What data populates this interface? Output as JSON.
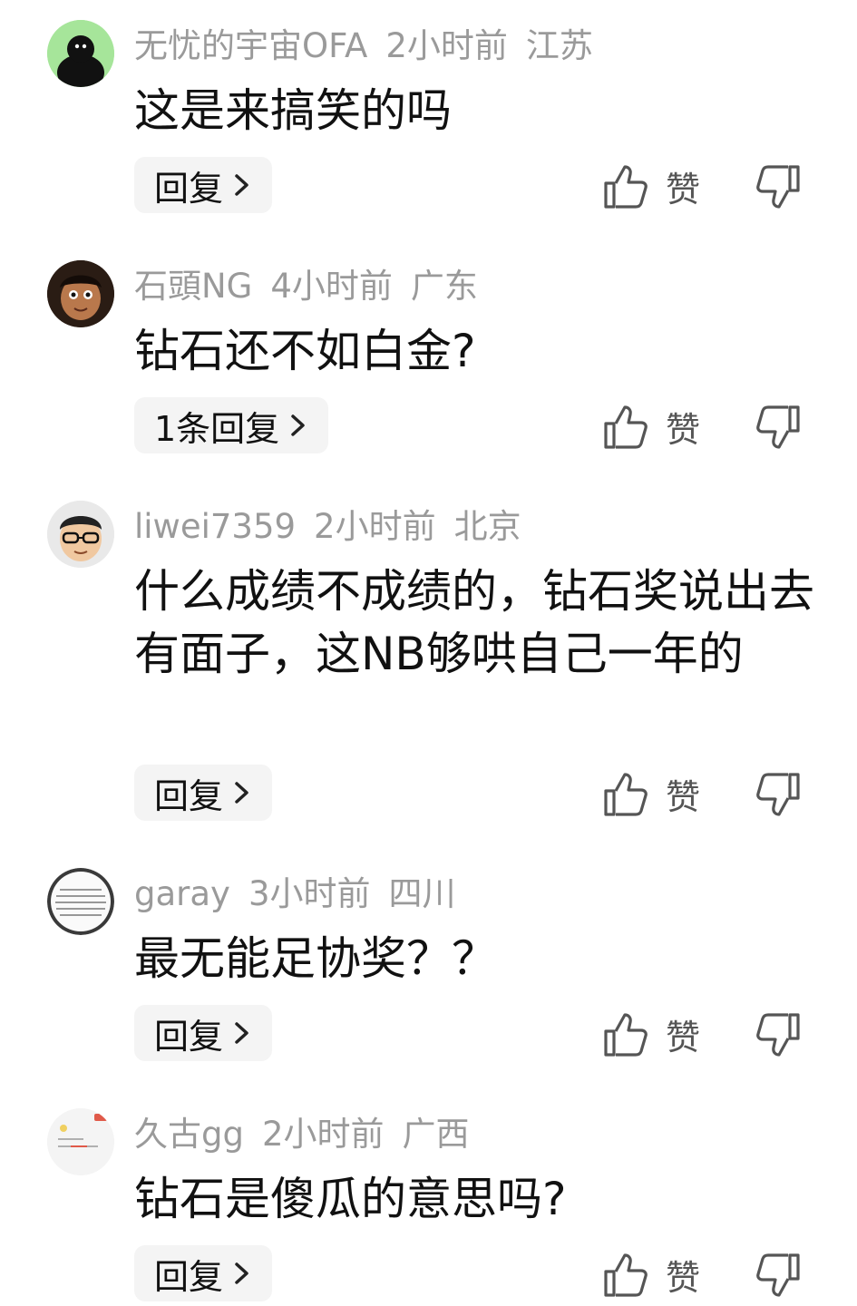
{
  "comments": [
    {
      "user": "无忧的宇宙OFA",
      "time": "2小时前",
      "location": "江苏",
      "text": "这是来搞笑的吗",
      "reply_label": "回复",
      "like_label": "赞"
    },
    {
      "user": "石頭NG",
      "time": "4小时前",
      "location": "广东",
      "text": "钻石还不如白金?",
      "reply_label": "1条回复",
      "like_label": "赞"
    },
    {
      "user": "liwei7359",
      "time": "2小时前",
      "location": "北京",
      "text": "什么成绩不成绩的，钻石奖说出去有面子，这NB够哄自己一年的",
      "reply_label": "回复",
      "like_label": "赞"
    },
    {
      "user": "garay",
      "time": "3小时前",
      "location": "四川",
      "text": "最无能足协奖？？",
      "reply_label": "回复",
      "like_label": "赞"
    },
    {
      "user": "久古gg",
      "time": "2小时前",
      "location": "广西",
      "text": "钻石是傻瓜的意思吗?",
      "reply_label": "回复",
      "like_label": "赞"
    }
  ],
  "icons": {
    "like": "thumbs-up-icon",
    "dislike": "thumbs-down-icon",
    "chevron": "chevron-right-icon"
  }
}
